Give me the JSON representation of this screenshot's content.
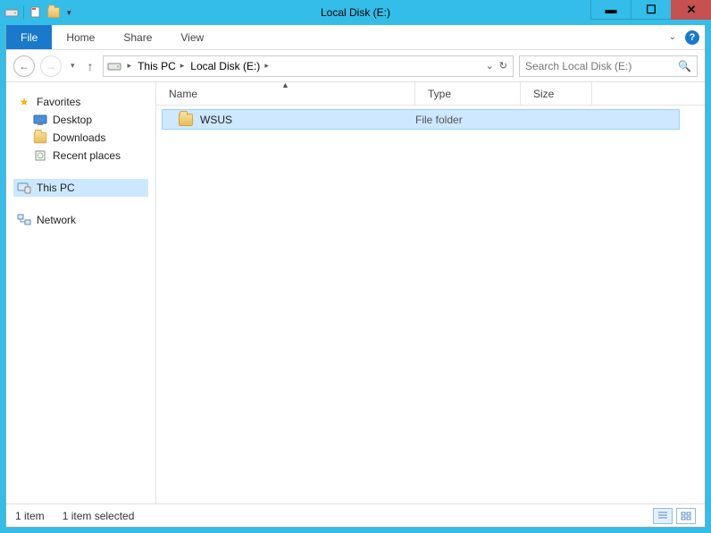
{
  "titlebar": {
    "title": "Local Disk (E:)"
  },
  "ribbon": {
    "file": "File",
    "tabs": [
      "Home",
      "Share",
      "View"
    ]
  },
  "nav": {
    "breadcrumb": [
      "This PC",
      "Local Disk (E:)"
    ],
    "search_placeholder": "Search Local Disk (E:)"
  },
  "navpane": {
    "favorites": {
      "label": "Favorites",
      "items": [
        {
          "label": "Desktop",
          "icon": "desktop-icon"
        },
        {
          "label": "Downloads",
          "icon": "downloads-icon"
        },
        {
          "label": "Recent places",
          "icon": "recent-icon"
        }
      ]
    },
    "thispc": {
      "label": "This PC"
    },
    "network": {
      "label": "Network"
    }
  },
  "columns": {
    "name": "Name",
    "type": "Type",
    "size": "Size"
  },
  "rows": [
    {
      "name": "WSUS",
      "type": "File folder",
      "size": "",
      "selected": true
    }
  ],
  "status": {
    "count": "1 item",
    "selection": "1 item selected"
  }
}
